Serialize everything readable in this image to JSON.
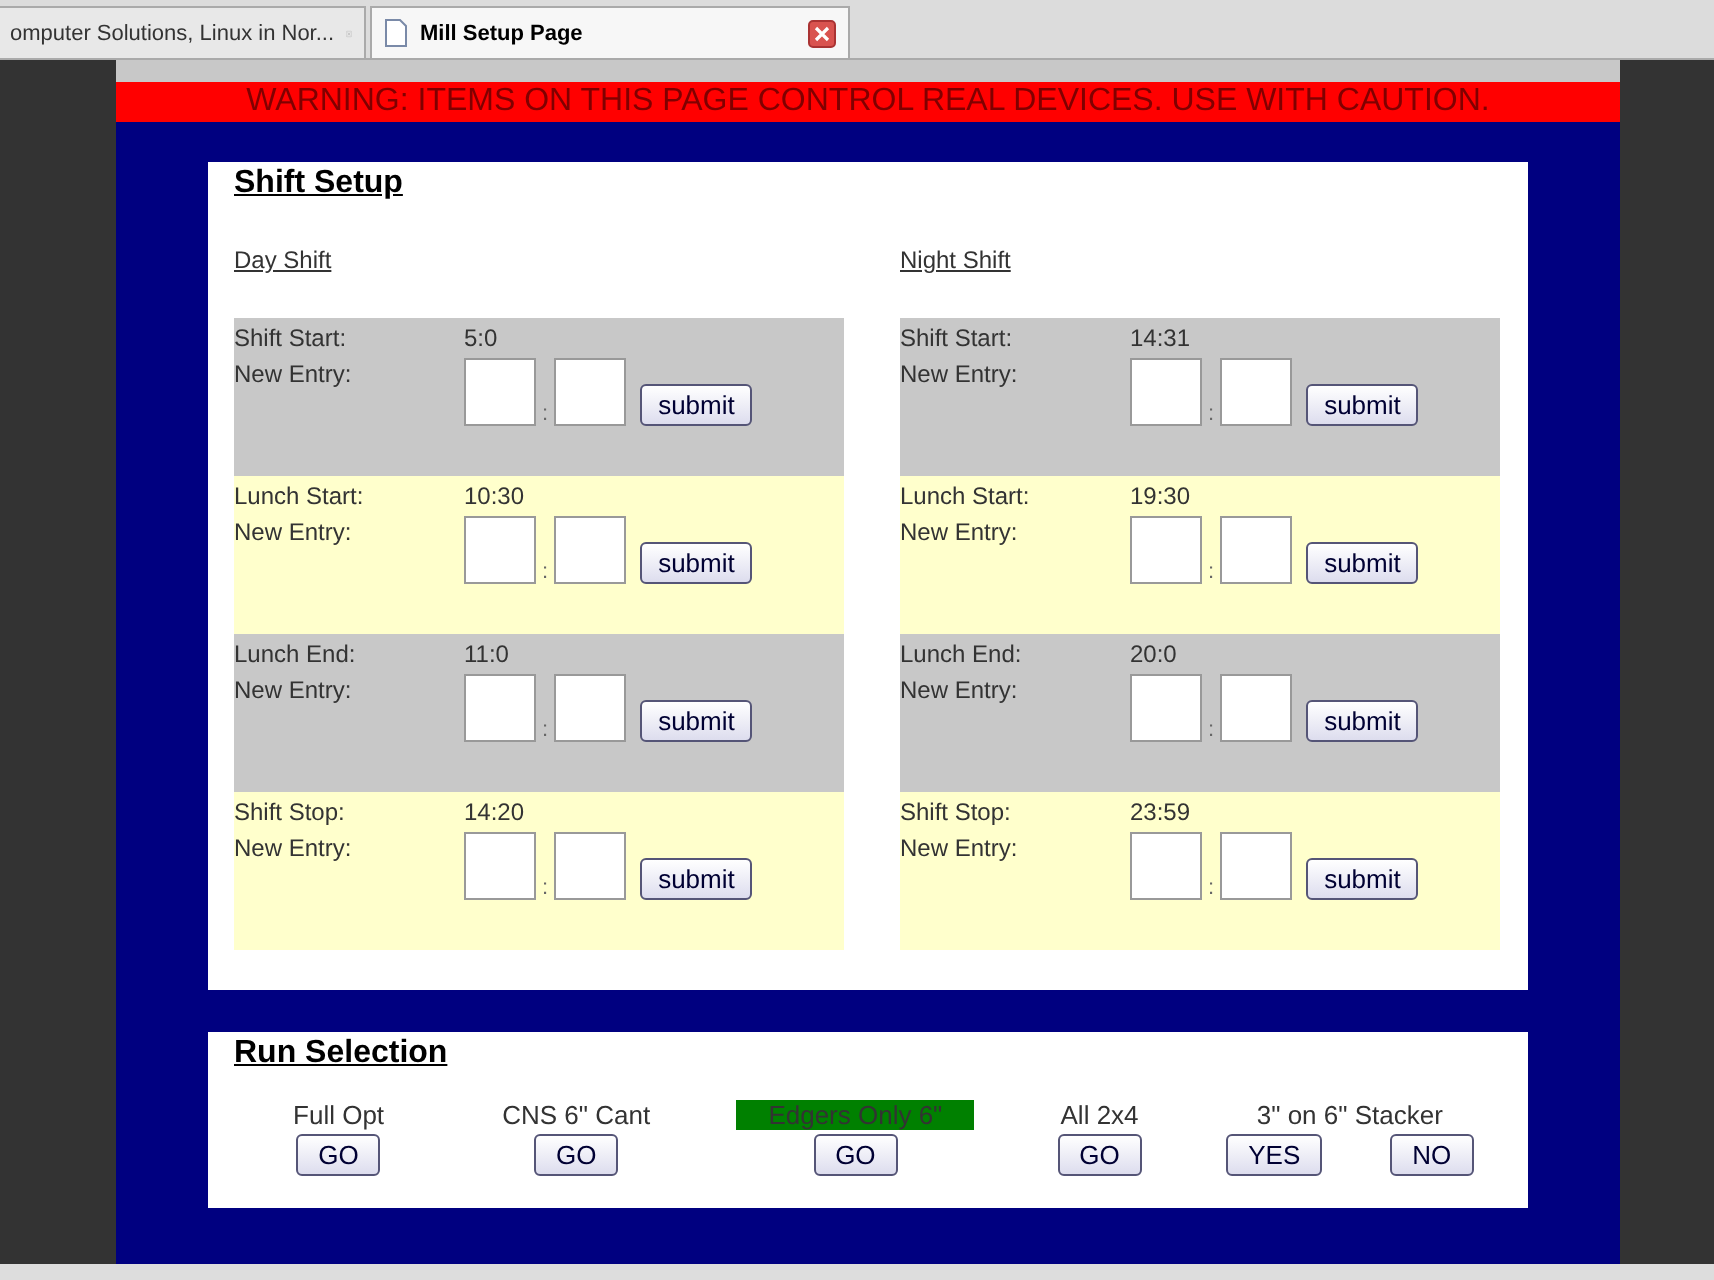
{
  "browser_tabs": [
    {
      "title": "omputer Solutions, Linux in Nor...",
      "selected": false
    },
    {
      "title": "Mill Setup Page",
      "selected": true
    }
  ],
  "warning": "WARNING:  ITEMS ON THIS PAGE CONTROL REAL DEVICES.  USE WITH CAUTION.",
  "shift_setup": {
    "title": "Shift Setup",
    "shifts": [
      {
        "name": "Day Shift",
        "rows": [
          {
            "label": "Shift Start:",
            "value": "5:0",
            "entry_label": "New Entry:",
            "separator": ":",
            "button": "submit"
          },
          {
            "label": "Lunch Start:",
            "value": "10:30",
            "entry_label": "New Entry:",
            "separator": ":",
            "button": "submit"
          },
          {
            "label": "Lunch End:",
            "value": "11:0",
            "entry_label": "New Entry:",
            "separator": ":",
            "button": "submit"
          },
          {
            "label": "Shift Stop:",
            "value": "14:20",
            "entry_label": "New Entry:",
            "separator": ":",
            "button": "submit"
          }
        ]
      },
      {
        "name": "Night Shift",
        "rows": [
          {
            "label": "Shift Start:",
            "value": "14:31",
            "entry_label": "New Entry:",
            "separator": ":",
            "button": "submit"
          },
          {
            "label": "Lunch Start:",
            "value": "19:30",
            "entry_label": "New Entry:",
            "separator": ":",
            "button": "submit"
          },
          {
            "label": "Lunch End:",
            "value": "20:0",
            "entry_label": "New Entry:",
            "separator": ":",
            "button": "submit"
          },
          {
            "label": "Shift Stop:",
            "value": "23:59",
            "entry_label": "New Entry:",
            "separator": ":",
            "button": "submit"
          }
        ]
      }
    ]
  },
  "run_selection": {
    "title": "Run Selection",
    "runs": [
      {
        "label": "Full Opt",
        "selected": false,
        "buttons": [
          "GO"
        ]
      },
      {
        "label": "CNS 6\" Cant",
        "selected": false,
        "buttons": [
          "GO"
        ]
      },
      {
        "label": "Edgers Only 6\"",
        "selected": true,
        "buttons": [
          "GO"
        ]
      },
      {
        "label": "All 2x4",
        "selected": false,
        "buttons": [
          "GO"
        ]
      },
      {
        "label": "3\" on 6\" Stacker",
        "selected": false,
        "buttons": [
          "YES",
          "NO"
        ]
      }
    ]
  }
}
